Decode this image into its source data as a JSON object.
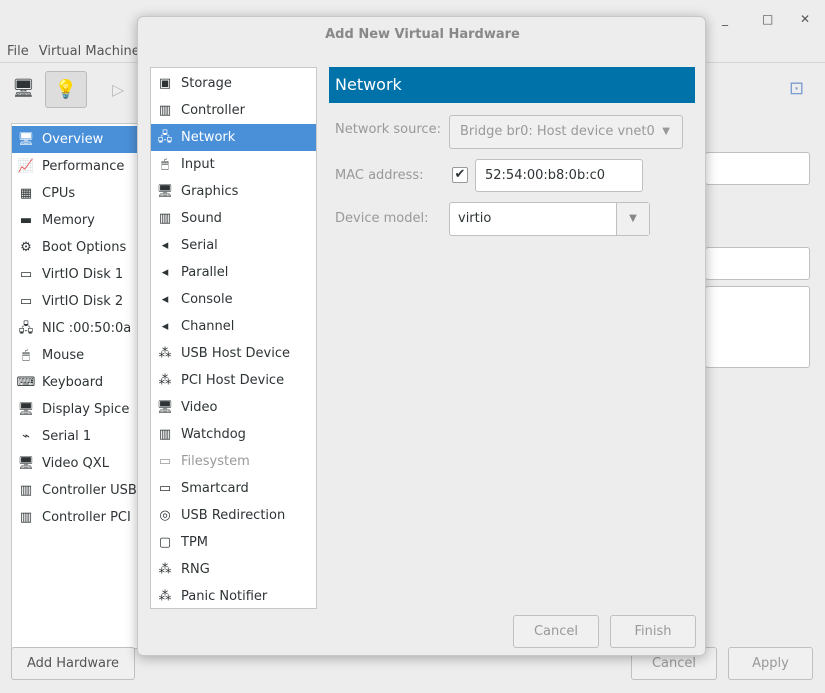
{
  "main_window": {
    "title": "",
    "controls": {
      "minimize": "_",
      "maximize": "□",
      "close": "✕"
    },
    "menu": [
      "File",
      "Virtual Machine"
    ],
    "hardware_list": [
      {
        "label": "Overview",
        "icon": "monitor-icon",
        "selected": true
      },
      {
        "label": "Performance",
        "icon": "chart-icon"
      },
      {
        "label": "CPUs",
        "icon": "cpu-icon"
      },
      {
        "label": "Memory",
        "icon": "memory-icon"
      },
      {
        "label": "Boot Options",
        "icon": "gears-icon"
      },
      {
        "label": "VirtIO Disk 1",
        "icon": "disk-icon"
      },
      {
        "label": "VirtIO Disk 2",
        "icon": "disk-icon"
      },
      {
        "label": "NIC :00:50:0a",
        "icon": "network-icon"
      },
      {
        "label": "Mouse",
        "icon": "mouse-icon"
      },
      {
        "label": "Keyboard",
        "icon": "keyboard-icon"
      },
      {
        "label": "Display Spice",
        "icon": "monitor-icon"
      },
      {
        "label": "Serial 1",
        "icon": "serial-icon"
      },
      {
        "label": "Video QXL",
        "icon": "monitor-icon"
      },
      {
        "label": "Controller USB",
        "icon": "card-icon"
      },
      {
        "label": "Controller PCI",
        "icon": "card-icon"
      }
    ],
    "add_hardware": "Add Hardware",
    "cancel": "Cancel",
    "apply": "Apply"
  },
  "dialog": {
    "title": "Add New Virtual Hardware",
    "items": [
      {
        "label": "Storage",
        "icon": "storage-icon"
      },
      {
        "label": "Controller",
        "icon": "card-icon"
      },
      {
        "label": "Network",
        "icon": "network-icon",
        "selected": true
      },
      {
        "label": "Input",
        "icon": "mouse-icon"
      },
      {
        "label": "Graphics",
        "icon": "monitor-icon"
      },
      {
        "label": "Sound",
        "icon": "card-icon"
      },
      {
        "label": "Serial",
        "icon": "plug-icon"
      },
      {
        "label": "Parallel",
        "icon": "plug-icon"
      },
      {
        "label": "Console",
        "icon": "plug-icon"
      },
      {
        "label": "Channel",
        "icon": "plug-icon"
      },
      {
        "label": "USB Host Device",
        "icon": "usb-icon"
      },
      {
        "label": "PCI Host Device",
        "icon": "usb-icon"
      },
      {
        "label": "Video",
        "icon": "monitor-icon"
      },
      {
        "label": "Watchdog",
        "icon": "card-icon"
      },
      {
        "label": "Filesystem",
        "icon": "folder-icon",
        "disabled": true
      },
      {
        "label": "Smartcard",
        "icon": "smartcard-icon"
      },
      {
        "label": "USB Redirection",
        "icon": "usb-redir-icon"
      },
      {
        "label": "TPM",
        "icon": "chip-icon"
      },
      {
        "label": "RNG",
        "icon": "usb-icon"
      },
      {
        "label": "Panic Notifier",
        "icon": "usb-icon"
      }
    ],
    "header": "Network",
    "header_color": "#0072aa",
    "network_source_label": "Network source:",
    "network_source_value": "Bridge br0: Host device vnet0",
    "mac_label": "MAC address:",
    "mac_checked": true,
    "mac_value": "52:54:00:b8:0b:c0",
    "device_model_label": "Device model:",
    "device_model_value": "virtio",
    "cancel": "Cancel",
    "finish": "Finish"
  }
}
